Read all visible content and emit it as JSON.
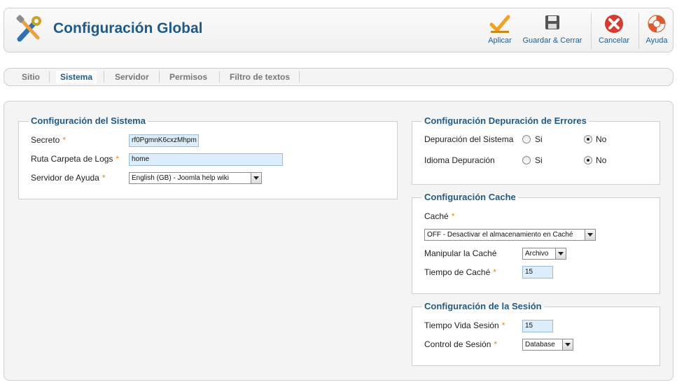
{
  "header": {
    "title": "Configuración Global",
    "buttons": {
      "apply": "Aplicar",
      "save_close": "Guardar & Cerrar",
      "cancel": "Cancelar",
      "help": "Ayuda"
    }
  },
  "tabs": {
    "sitio": "Sitio",
    "sistema": "Sistema",
    "servidor": "Servidor",
    "permisos": "Permisos",
    "filtro": "Filtro de textos",
    "active": "Sistema"
  },
  "system_config": {
    "legend": "Configuración del Sistema",
    "secret_label": "Secreto",
    "secret_value": "rf0PgmnK6cxzMhpm",
    "logs_label": "Ruta Carpeta de Logs",
    "logs_value": "home",
    "help_server_label": "Servidor de Ayuda",
    "help_server_value": "English (GB) - Joomla help wiki"
  },
  "debug_config": {
    "legend": "Configuración Depuración de Errores",
    "system_debug_label": "Depuración del Sistema",
    "lang_debug_label": "Idioma Depuración",
    "yes": "Si",
    "no": "No",
    "system_debug_selected": "No",
    "lang_debug_selected": "No"
  },
  "cache_config": {
    "legend": "Configuración Cache",
    "cache_label": "Caché",
    "cache_value": "OFF - Desactivar el almacenamiento en Caché",
    "handler_label": "Manipular la Caché",
    "handler_value": "Archivo",
    "time_label": "Tiempo de Caché",
    "time_value": "15"
  },
  "session_config": {
    "legend": "Configuración de la Sesión",
    "lifetime_label": "Tiempo Vida Sesión",
    "lifetime_value": "15",
    "handler_label": "Control de Sesión",
    "handler_value": "Database"
  },
  "colors": {
    "title": "#1e5a8a",
    "required_star": "#e68a00",
    "input_bg": "#dceefb"
  },
  "icons": [
    "tools-icon",
    "checkmark-icon",
    "floppy-disk-icon",
    "cancel-icon",
    "lifebuoy-icon"
  ]
}
